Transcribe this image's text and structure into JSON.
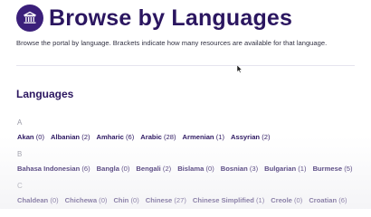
{
  "header": {
    "title": "Browse by Languages",
    "logo_icon": "building-icon"
  },
  "intro": "Browse the portal by language. Brackets indicate how many resources are available for that language.",
  "languages_section": {
    "heading": "Languages",
    "groups": [
      {
        "letter": "A",
        "items": [
          {
            "name": "Akan",
            "count": "(0)"
          },
          {
            "name": "Albanian",
            "count": "(2)"
          },
          {
            "name": "Amharic",
            "count": "(6)"
          },
          {
            "name": "Arabic",
            "count": "(28)"
          },
          {
            "name": "Armenian",
            "count": "(1)"
          },
          {
            "name": "Assyrian",
            "count": "(2)"
          }
        ]
      },
      {
        "letter": "B",
        "items": [
          {
            "name": "Bahasa Indonesian",
            "count": "(6)"
          },
          {
            "name": "Bangla",
            "count": "(0)"
          },
          {
            "name": "Bengali",
            "count": "(2)"
          },
          {
            "name": "Bislama",
            "count": "(0)"
          },
          {
            "name": "Bosnian",
            "count": "(3)"
          },
          {
            "name": "Bulgarian",
            "count": "(1)"
          },
          {
            "name": "Burmese",
            "count": "(5)"
          }
        ]
      },
      {
        "letter": "C",
        "items": [
          {
            "name": "Chaldean",
            "count": "(0)"
          },
          {
            "name": "Chichewa",
            "count": "(0)"
          },
          {
            "name": "Chin",
            "count": "(0)"
          },
          {
            "name": "Chinese",
            "count": "(27)"
          },
          {
            "name": "Chinese Simplified",
            "count": "(1)"
          },
          {
            "name": "Creole",
            "count": "(0)"
          },
          {
            "name": "Croatian",
            "count": "(6)"
          }
        ]
      }
    ]
  },
  "colors": {
    "brand": "#2b1660",
    "logo_bg": "#3b1f7a",
    "letter_gray": "#9a9aa6"
  }
}
